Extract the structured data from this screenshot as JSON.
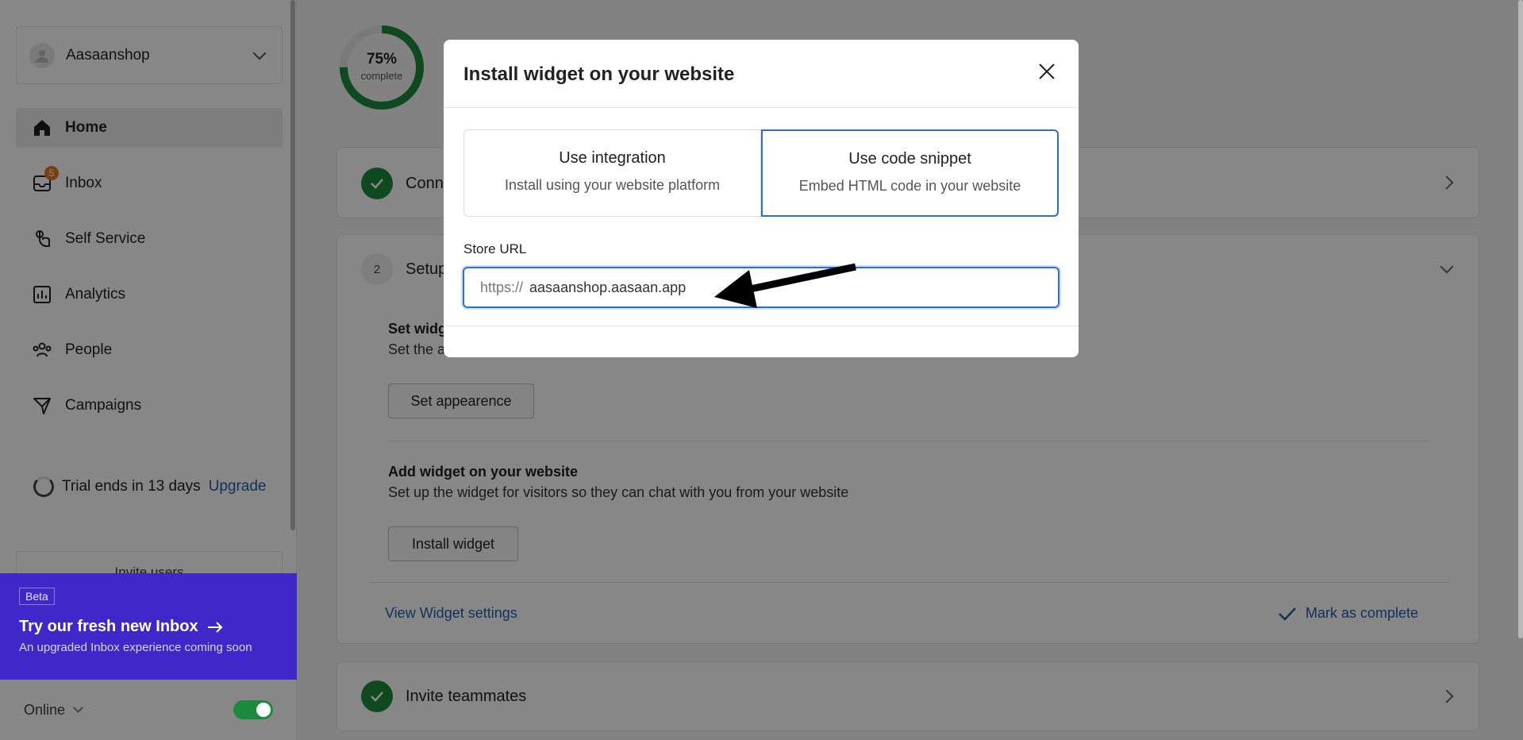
{
  "sidebar": {
    "workspace_name": "Aasaanshop",
    "nav": [
      {
        "label": "Home",
        "icon": "home-icon",
        "active": true
      },
      {
        "label": "Inbox",
        "icon": "inbox-icon",
        "badge": "5"
      },
      {
        "label": "Self Service",
        "icon": "self-service-icon"
      },
      {
        "label": "Analytics",
        "icon": "analytics-icon"
      },
      {
        "label": "People",
        "icon": "people-icon"
      },
      {
        "label": "Campaigns",
        "icon": "campaigns-icon"
      }
    ],
    "trial_text": "Trial ends in 13 days",
    "upgrade_label": "Upgrade",
    "invite_users_label": "Invite users",
    "beta": {
      "tag": "Beta",
      "title": "Try our fresh new Inbox",
      "subtitle": "An upgraded Inbox experience coming soon"
    },
    "status": {
      "label": "Online",
      "toggle_on": true,
      "toggle_color": "#1c8a3c"
    }
  },
  "main": {
    "progress": {
      "percent_label": "75%",
      "sub_label": "complete",
      "fraction": 0.75
    },
    "cards": {
      "connect": {
        "title": "Conn"
      },
      "setup": {
        "step": "2",
        "title": "Setup",
        "set_widget_title": "Set widg",
        "set_widget_desc": "Set the a",
        "set_appearance_button": "Set appearence",
        "add_widget_title": "Add widget on your website",
        "add_widget_desc": "Set up the widget for visitors so they can chat with you from your website",
        "install_button": "Install widget",
        "view_settings_link": "View Widget settings",
        "mark_complete_label": "Mark as complete"
      },
      "invite": {
        "title": "Invite teammates"
      }
    }
  },
  "modal": {
    "title": "Install widget on your website",
    "options": [
      {
        "title": "Use integration",
        "subtitle": "Install using your website platform",
        "selected": false
      },
      {
        "title": "Use code snippet",
        "subtitle": "Embed HTML code in your website",
        "selected": true
      }
    ],
    "store_url": {
      "label": "Store URL",
      "prefix": "https://",
      "value": "aasaanshop.aasaan.app"
    }
  },
  "colors": {
    "accent": "#2b6fd6",
    "success": "#1c8a3c",
    "beta_bg": "#3e28c9",
    "link": "#1f5fa8"
  }
}
